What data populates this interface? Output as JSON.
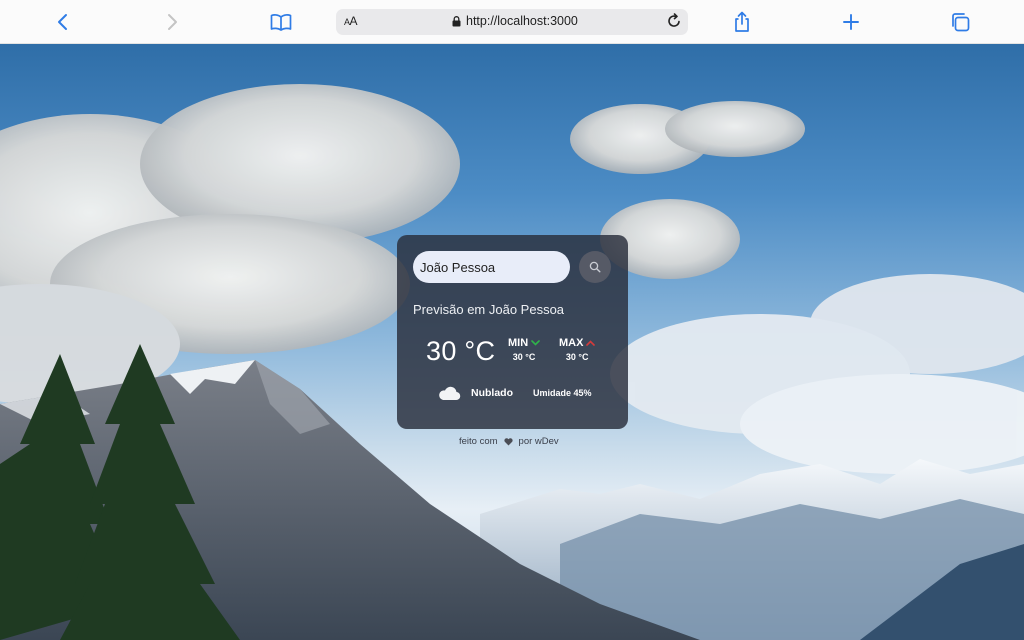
{
  "browser": {
    "reader_label": "AA",
    "url": "http://localhost:3000"
  },
  "icons": {
    "back": "chevron-left-icon",
    "forward": "chevron-right-icon",
    "bookmarks": "book-icon",
    "lock": "lock-icon",
    "reload": "reload-icon",
    "share": "share-icon",
    "new_tab": "plus-icon",
    "tabs": "tabs-icon",
    "search": "search-icon",
    "weather": "cloud-icon",
    "min_arrow": "chevron-down-icon",
    "max_arrow": "chevron-up-icon",
    "heart": "heart-icon"
  },
  "weather": {
    "search_value": "João Pessoa",
    "title": "Previsão em João Pessoa",
    "temperature": "30 °C",
    "min_label": "MIN",
    "min_value": "30 °C",
    "max_label": "MAX",
    "max_value": "30 °C",
    "condition": "Nublado",
    "humidity": "Umidade 45%"
  },
  "footer": {
    "made_with": "feito com",
    "by": "por wDev"
  },
  "colors": {
    "accent": "#2f7ce6",
    "card_bg": "#282d3a",
    "min_arrow": "#2fb34a",
    "max_arrow": "#d33b3b"
  }
}
